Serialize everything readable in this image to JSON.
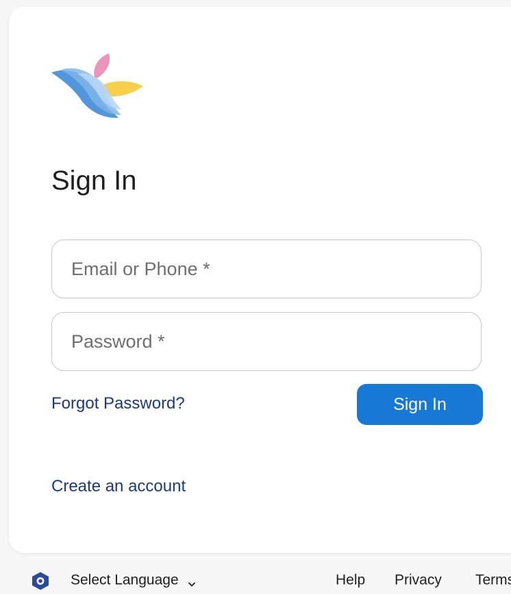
{
  "signin": {
    "title": "Sign In",
    "email_placeholder": "Email or Phone *",
    "password_placeholder": "Password *",
    "forgot_password": "Forgot Password?",
    "submit_label": "Sign In",
    "create_account": "Create an account"
  },
  "footer": {
    "language_label": "Select Language",
    "links": [
      "Help",
      "Privacy",
      "Terms"
    ]
  },
  "icons": {
    "logo": "bird-logo",
    "language": "gear-icon",
    "dropdown": "chevron-down-icon"
  },
  "colors": {
    "primary_button": "#1878d6",
    "link": "#1a3a7e",
    "logo_blue": "#4a90d9",
    "logo_pink": "#e88bb5",
    "logo_yellow": "#f7cf4a"
  }
}
